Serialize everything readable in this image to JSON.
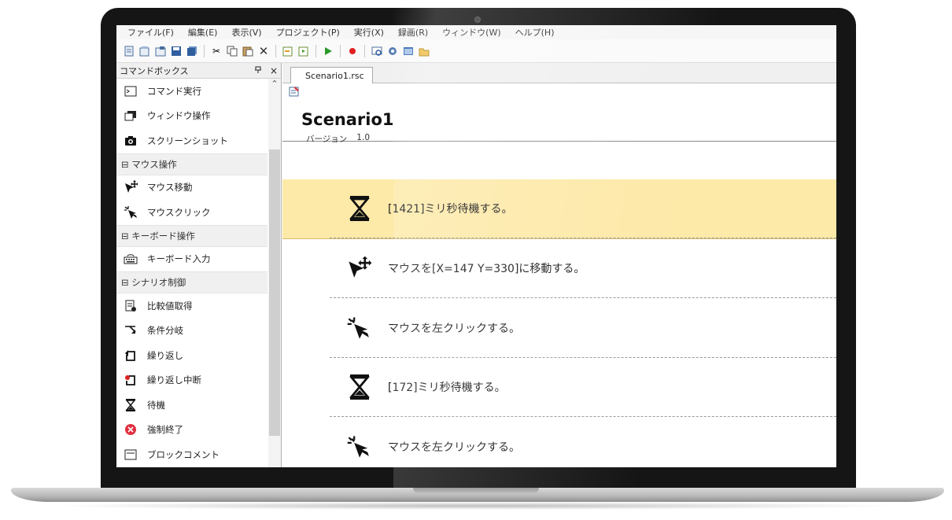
{
  "menu": [
    "ファイル(F)",
    "編集(E)",
    "表示(V)",
    "プロジェクト(P)",
    "実行(X)",
    "録画(R)",
    "ウィンドウ(W)",
    "ヘルプ(H)"
  ],
  "panel": {
    "title": "コマンドボックス",
    "pin_icon": "pin-icon",
    "close_label": "×"
  },
  "commands": [
    {
      "kind": "item",
      "icon": "console-icon",
      "label": "コマンド実行"
    },
    {
      "kind": "item",
      "icon": "window-icon",
      "label": "ウィンドウ操作"
    },
    {
      "kind": "item",
      "icon": "camera-icon",
      "label": "スクリーンショット"
    },
    {
      "kind": "group",
      "label": "⊟ マウス操作"
    },
    {
      "kind": "item",
      "icon": "mouse-move-icon",
      "label": "マウス移動"
    },
    {
      "kind": "item",
      "icon": "mouse-click-icon",
      "label": "マウスクリック"
    },
    {
      "kind": "group",
      "label": "⊟ キーボード操作"
    },
    {
      "kind": "item",
      "icon": "keyboard-icon",
      "label": "キーボード入力"
    },
    {
      "kind": "group",
      "label": "⊟ シナリオ制御"
    },
    {
      "kind": "item",
      "icon": "compare-icon",
      "label": "比較値取得"
    },
    {
      "kind": "item",
      "icon": "branch-icon",
      "label": "条件分岐"
    },
    {
      "kind": "item",
      "icon": "loop-icon",
      "label": "繰り返し"
    },
    {
      "kind": "item",
      "icon": "loop-break-icon",
      "label": "繰り返し中断"
    },
    {
      "kind": "item",
      "icon": "hourglass-icon",
      "label": "待機"
    },
    {
      "kind": "item",
      "icon": "force-stop-icon",
      "label": "強制終了"
    },
    {
      "kind": "item",
      "icon": "block-comment-icon",
      "label": "ブロックコメント"
    }
  ],
  "tab": {
    "label": "Scenario1.rsc"
  },
  "scenario": {
    "title": "Scenario1",
    "version_label": "バージョン",
    "version_value": "1.0"
  },
  "steps": [
    {
      "icon": "hourglass-icon",
      "text": "[1421]ミリ秒待機する。",
      "selected": true
    },
    {
      "icon": "mouse-move-icon",
      "text": "マウスを[X=147 Y=330]に移動する。",
      "selected": false
    },
    {
      "icon": "mouse-click-icon",
      "text": "マウスを左クリックする。",
      "selected": false
    },
    {
      "icon": "hourglass-icon",
      "text": "[172]ミリ秒待機する。",
      "selected": false
    },
    {
      "icon": "mouse-click-icon",
      "text": "マウスを左クリックする。",
      "selected": false
    }
  ],
  "colors": {
    "selected_row": "#fde9a8",
    "panel_bg": "#efefef",
    "laptop_bezel": "#151515"
  }
}
